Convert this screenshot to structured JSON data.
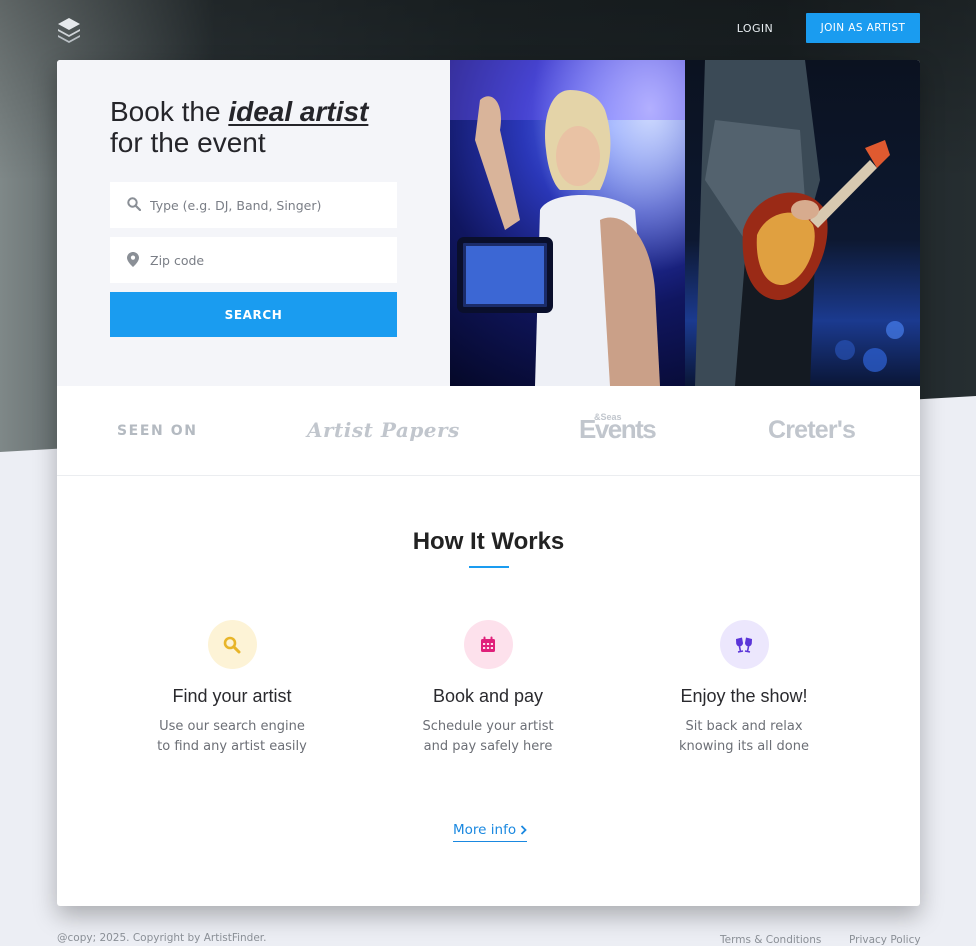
{
  "nav": {
    "login_label": "LOGIN",
    "join_label": "JOIN AS ARTIST"
  },
  "hero": {
    "title_prefix": "Book the ",
    "title_emphasis": "ideal artist",
    "title_suffix": "for the event",
    "type_placeholder": "Type (e.g. DJ, Band, Singer)",
    "zip_placeholder": "Zip code",
    "search_label": "SEARCH"
  },
  "seen_on": {
    "label": "SEEN ON",
    "publications": [
      "Artist Papers",
      "Events",
      "Creter's"
    ],
    "events_superscript": "&Seas"
  },
  "how_it_works": {
    "title": "How It Works",
    "steps": [
      {
        "title": "Find your artist",
        "line1": "Use our search engine",
        "line2": "to find any artist easily",
        "icon": "search-icon",
        "icon_color": "#e8b52a",
        "icon_bg": "#fdf3d6"
      },
      {
        "title": "Book and pay",
        "line1": "Schedule your artist",
        "line2": "and pay safely here",
        "icon": "calendar-icon",
        "icon_color": "#e0207a",
        "icon_bg": "#fde1ec"
      },
      {
        "title": "Enjoy the show!",
        "line1": "Sit back and relax",
        "line2": "knowing its all done",
        "icon": "cheers-icon",
        "icon_color": "#5b35d8",
        "icon_bg": "#ece7fd"
      }
    ],
    "more_info_label": "More info"
  },
  "footer": {
    "copyright": "@copy; 2025. Copyright by ArtistFinder.",
    "terms_label": "Terms & Conditions",
    "privacy_label": "Privacy Policy"
  },
  "colors": {
    "accent": "#1a9cf0",
    "link": "#1a88e0"
  }
}
